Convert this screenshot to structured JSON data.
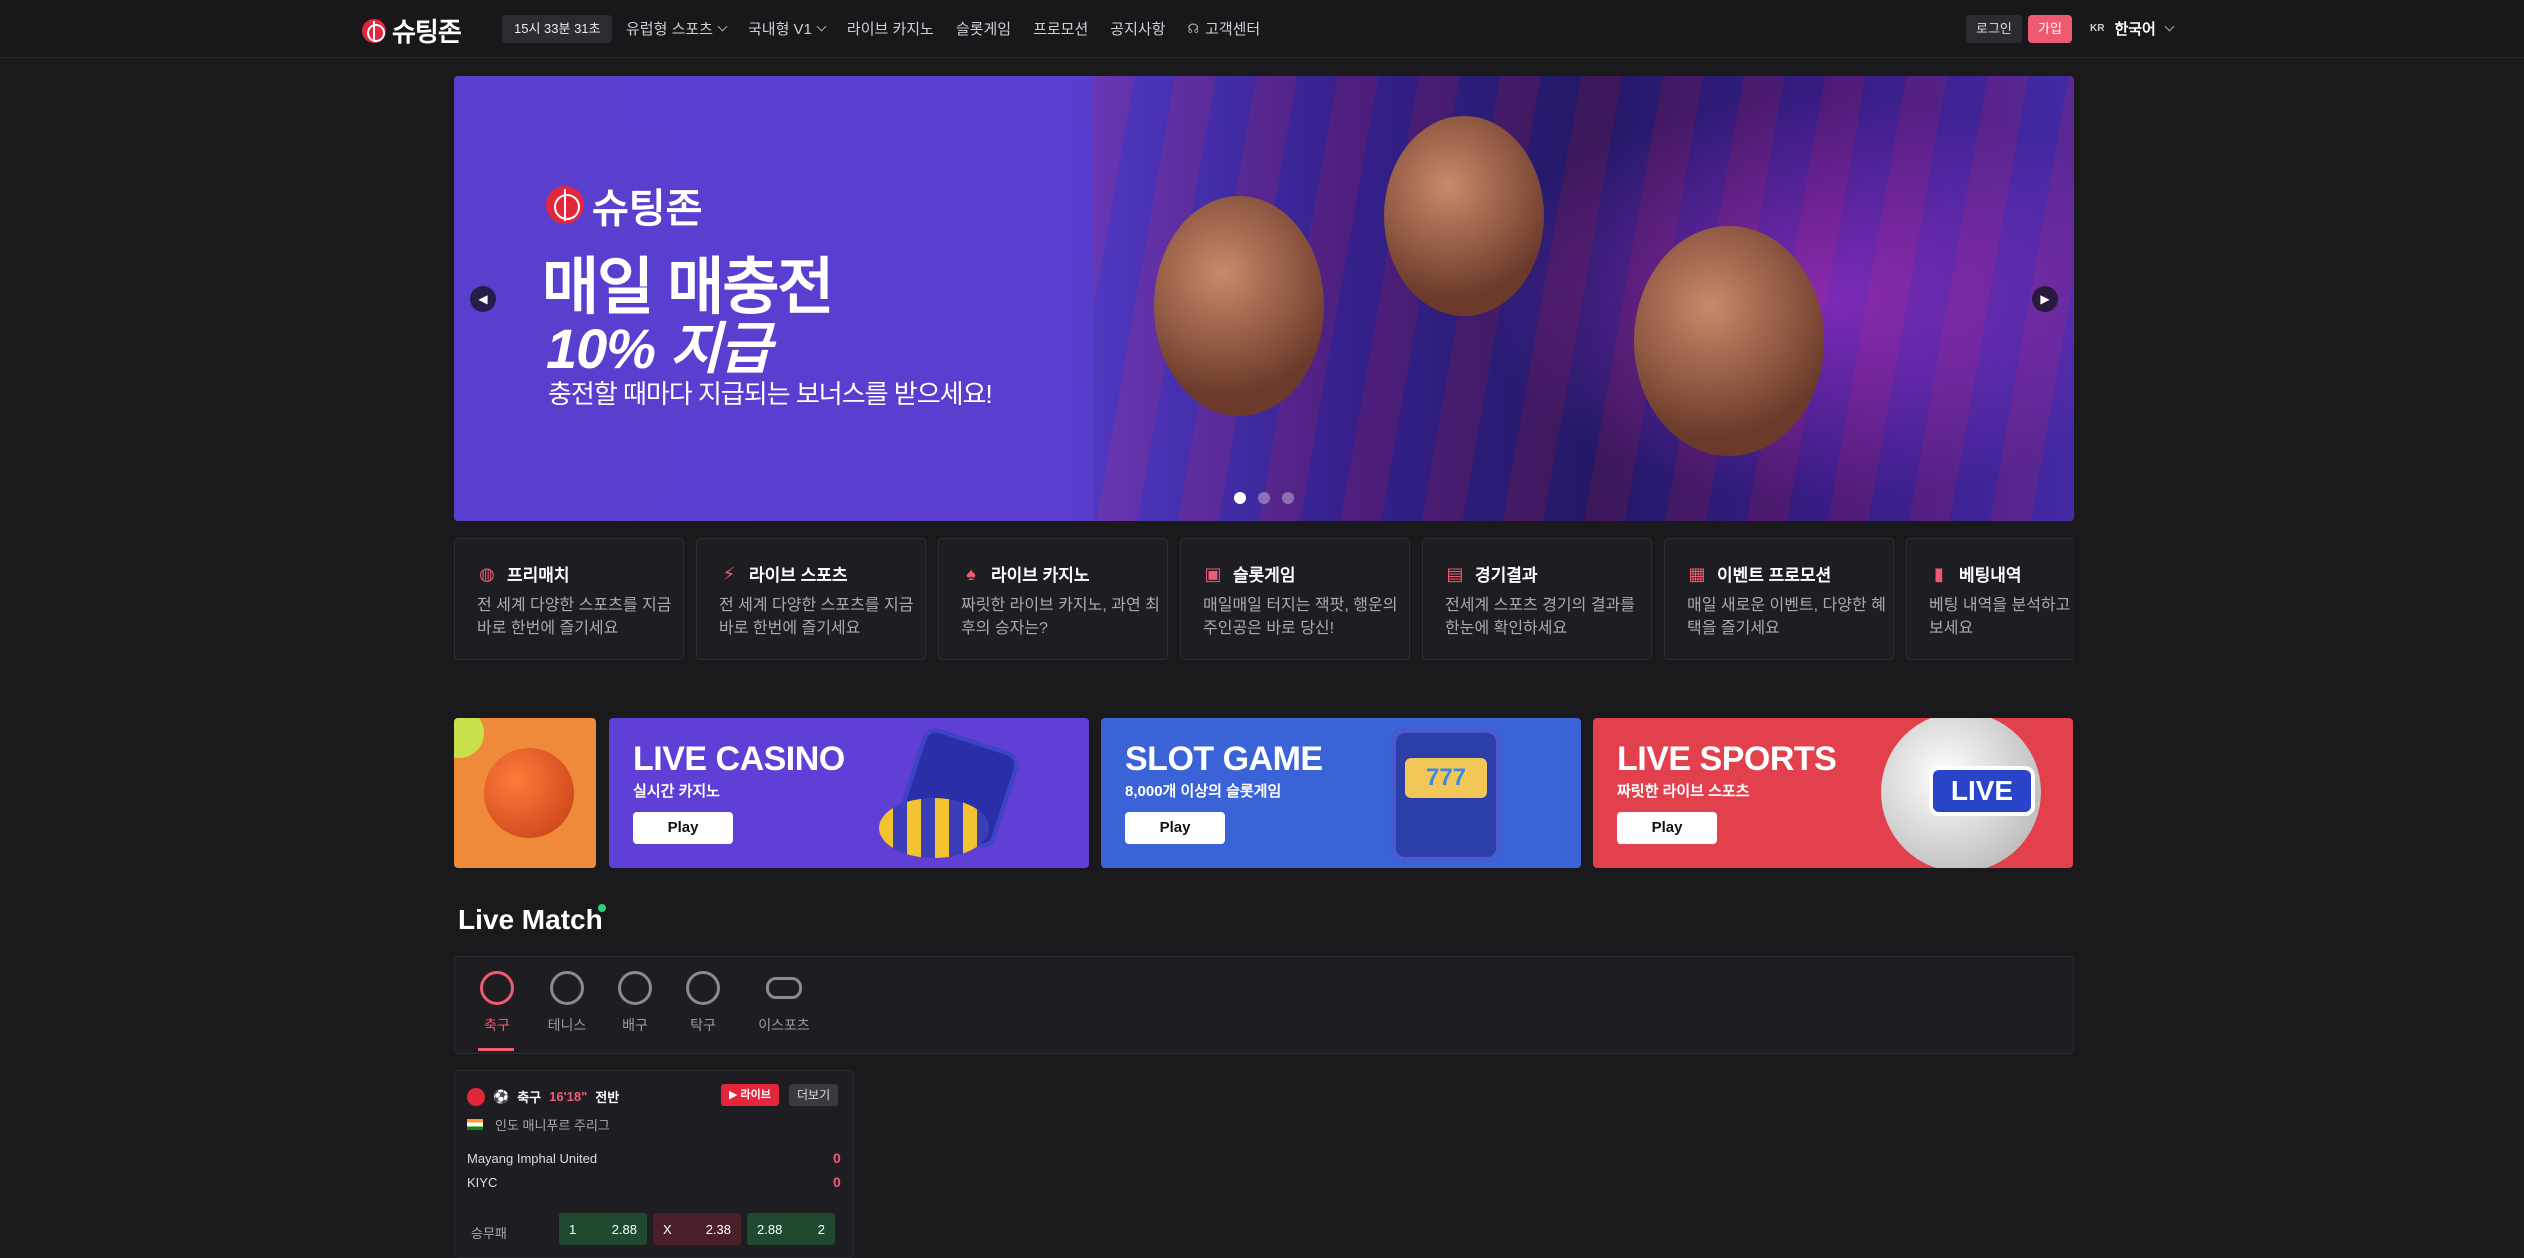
{
  "header": {
    "logo_text": "슈팅존",
    "clock": "15시 33분 31초",
    "nav": [
      {
        "label": "유럽형 스포츠",
        "dropdown": true
      },
      {
        "label": "국내형 V1",
        "dropdown": true
      },
      {
        "label": "라이브 카지노",
        "dropdown": false
      },
      {
        "label": "슬롯게임",
        "dropdown": false
      },
      {
        "label": "프로모션",
        "dropdown": false
      },
      {
        "label": "공지사항",
        "dropdown": false
      },
      {
        "label": "고객센터",
        "dropdown": false,
        "icon": "headset-icon"
      }
    ],
    "login_label": "로그인",
    "join_label": "가입",
    "lang_code": "KR",
    "lang_label": "한국어"
  },
  "hero": {
    "logo_text": "슈팅존",
    "title_line1": "매일 매충전",
    "title_line2": "10% 지급",
    "subtitle": "충전할 때마다 지급되는 보너스를 받으세요!",
    "slide_count": 3,
    "active_slide": 1
  },
  "quick_links": [
    {
      "title": "프리매치",
      "desc": "전 세계 다양한 스포츠를 지금 바로 한번에 즐기세요",
      "icon": "basketball-icon"
    },
    {
      "title": "라이브 스포츠",
      "desc": "전 세계 다양한 스포츠를 지금 바로 한번에 즐기세요",
      "icon": "runner-icon"
    },
    {
      "title": "라이브 카지노",
      "desc": "짜릿한 라이브 카지노, 과연 최후의 승자는?",
      "icon": "spade-icon"
    },
    {
      "title": "슬롯게임",
      "desc": "매일매일 터지는 잭팟, 행운의 주인공은 바로 당신!",
      "icon": "slot-machine-icon"
    },
    {
      "title": "경기결과",
      "desc": "전세계 스포츠 경기의 결과를 한눈에 확인하세요",
      "icon": "scoreboard-icon"
    },
    {
      "title": "이벤트 프로모션",
      "desc": "매일 새로운 이벤트, 다양한 혜택을 즐기세요",
      "icon": "gift-icon"
    },
    {
      "title": "베팅내역",
      "desc": "베팅 내역을 분석하고 을 높혀보세요",
      "icon": "receipt-icon"
    }
  ],
  "promos": [
    {
      "title": "",
      "subtitle": "",
      "play": "",
      "color": "#ef8a3a",
      "icon": "sports-balls-icon"
    },
    {
      "title": "LIVE CASINO",
      "subtitle": "실시간 카지노",
      "play": "Play",
      "color": "#5f3fd6",
      "icon": "dice-chips-icon"
    },
    {
      "title": "SLOT GAME",
      "subtitle": "8,000개 이상의 슬롯게임",
      "play": "Play",
      "color": "#3a63d8",
      "icon": "slot-machine-icon"
    },
    {
      "title": "LIVE SPORTS",
      "subtitle": "짜릿한 라이브 스포츠",
      "play": "Play",
      "color": "#e2404c",
      "icon": "soccer-ball-live-icon"
    }
  ],
  "live_match": {
    "title": "Live Match",
    "tabs": [
      {
        "label": "축구",
        "icon": "soccer-icon",
        "active": true
      },
      {
        "label": "테니스",
        "icon": "tennis-icon",
        "active": false
      },
      {
        "label": "배구",
        "icon": "volleyball-icon",
        "active": false
      },
      {
        "label": "탁구",
        "icon": "table-tennis-icon",
        "active": false
      },
      {
        "label": "이스포츠",
        "icon": "gamepad-icon",
        "active": false
      }
    ],
    "match": {
      "sport": "축구",
      "time": "16'18\"",
      "period": "전반",
      "live_label": "▶ 라이브",
      "more_label": "더보기",
      "league": "인도 매니푸르 주리그",
      "home": "Mayang Imphal United",
      "away": "KIYC",
      "home_score": "0",
      "away_score": "0",
      "market": "승무패",
      "odds": [
        {
          "label": "1",
          "value": "2.88"
        },
        {
          "label": "X",
          "value": "2.38"
        },
        {
          "label": "2",
          "value": "2.88"
        }
      ]
    }
  },
  "colors": {
    "accent": "#f05a73",
    "bg": "#1a1a1d",
    "card": "#1e1e22",
    "live_red": "#e3263b"
  }
}
